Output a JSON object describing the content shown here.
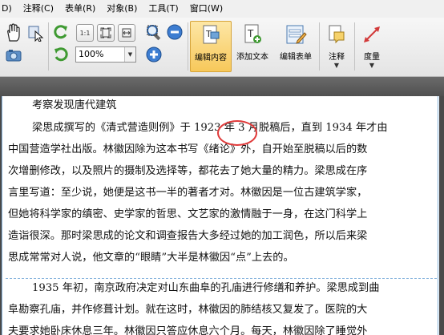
{
  "menu": [
    "D)",
    "注释(C)",
    "表单(R)",
    "对象(B)",
    "工具(T)",
    "窗口(W)"
  ],
  "toolbar": {
    "zoom_value": "100%",
    "buttons": [
      {
        "label": "编辑内容",
        "active": true
      },
      {
        "label": "添加文本"
      },
      {
        "label": "编辑表单"
      },
      {
        "label": "注释"
      },
      {
        "label": "度量"
      }
    ]
  },
  "document": {
    "lines": [
      "考察发现唐代建筑",
      "梁思成撰写的《清式营造则例》于 1923 年 3 月脱稿后，直到 1934 年才由",
      "中国营造学社出版。林徽因除为这本书写《绪论》外，自开始至脱稿以后的数",
      "次增删修改，以及照片的摄制及选择等，都花去了她大量的精力。梁思成在序",
      "言里写道：至少说，她便是这书一半的著者才对。林徽因是一位古建筑学家，",
      "但她将科学家的缜密、史学家的哲思、文艺家的激情融于一身，在这门科学上",
      "造诣很深。那时梁思成的论文和调查报告大多经过她的加工润色，所以后来梁",
      "思成常常对人说，他文章的“眼睛”大半是林徽因“点”上去的。",
      "1935 年初，南京政府决定对山东曲阜的孔庙进行修缮和养护。梁思成到曲",
      "阜勘察孔庙，并作修葺计划。就在这时，林徽因的肺结核又复发了。医院的大",
      "夫要求她卧床休息三年。林徽因只答应休息六个月。每天，林徽因除了睡觉外"
    ]
  },
  "colors": {
    "highlight_circle": "#e03b3b",
    "guide": "#8ab6de",
    "active_button": "#f7c85a"
  }
}
